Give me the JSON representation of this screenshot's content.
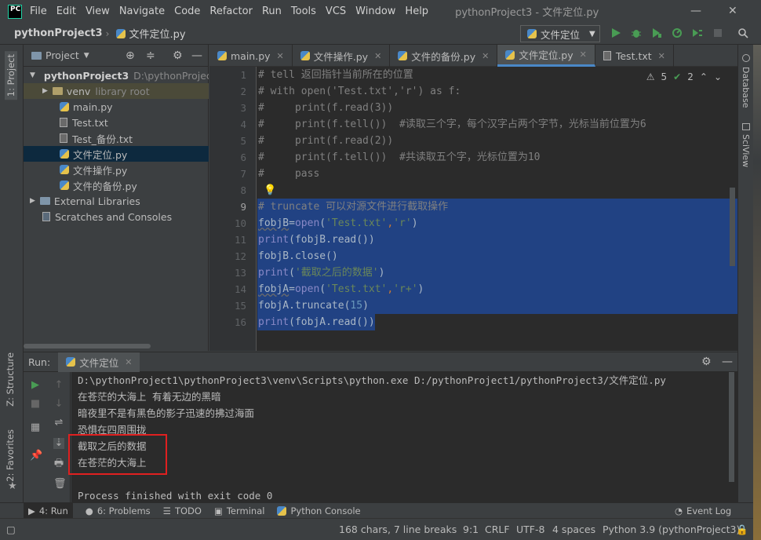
{
  "menubar": {
    "logo": "PC",
    "items": [
      "File",
      "Edit",
      "View",
      "Navigate",
      "Code",
      "Refactor",
      "Run",
      "Tools",
      "VCS",
      "Window",
      "Help"
    ],
    "window_title": "pythonProject3 - 文件定位.py"
  },
  "navbar": {
    "project": "pythonProject3",
    "file": "文件定位.py",
    "run_config": "文件定位"
  },
  "left_tabs": {
    "project": "1: Project",
    "structure": "Z: Structure",
    "favorites": "2: Favorites"
  },
  "right_tabs": {
    "database": "Database",
    "sciview": "SciView"
  },
  "project_panel": {
    "title": "Project",
    "tree": [
      {
        "label": "pythonProject3",
        "extra": "D:\\pythonProjec"
      },
      {
        "label": "venv",
        "extra": "library root"
      },
      {
        "label": "main.py"
      },
      {
        "label": "Test.txt"
      },
      {
        "label": "Test_备份.txt"
      },
      {
        "label": "文件定位.py"
      },
      {
        "label": "文件操作.py"
      },
      {
        "label": "文件的备份.py"
      },
      {
        "label": "External Libraries"
      },
      {
        "label": "Scratches and Consoles"
      }
    ]
  },
  "editor": {
    "tabs": [
      "main.py",
      "文件操作.py",
      "文件的备份.py",
      "文件定位.py",
      "Test.txt"
    ],
    "inspections": {
      "warnings": "5",
      "weak": "2"
    },
    "line_numbers": [
      "1",
      "2",
      "3",
      "4",
      "5",
      "6",
      "7",
      "8",
      "9",
      "10",
      "11",
      "12",
      "13",
      "14",
      "15",
      "16"
    ]
  },
  "run": {
    "label": "Run:",
    "tab": "文件定位",
    "output": [
      "D:\\pythonProject1\\pythonProject3\\venv\\Scripts\\python.exe D:/pythonProject1/pythonProject3/文件定位.py",
      "在苍茫的大海上 有着无边的黑暗",
      "暗夜里不是有黑色的影子迅速的拂过海面",
      "恐惧在四周围拢",
      "截取之后的数据",
      "在苍茫的大海上",
      "",
      "Process finished with exit code 0"
    ]
  },
  "bottom_tabs": {
    "run": "4: Run",
    "problems": "6: Problems",
    "todo": "TODO",
    "terminal": "Terminal",
    "python_console": "Python Console",
    "event_log": "Event Log"
  },
  "status": {
    "chars": "168 chars, 7 line breaks",
    "position": "9:1",
    "line_sep": "CRLF",
    "encoding": "UTF-8",
    "indent": "4 spaces",
    "interpreter": "Python 3.9 (pythonProject3)"
  },
  "colors": {
    "accent": "#4a88c7",
    "highlight": "#e02020",
    "selection": "#214283"
  }
}
